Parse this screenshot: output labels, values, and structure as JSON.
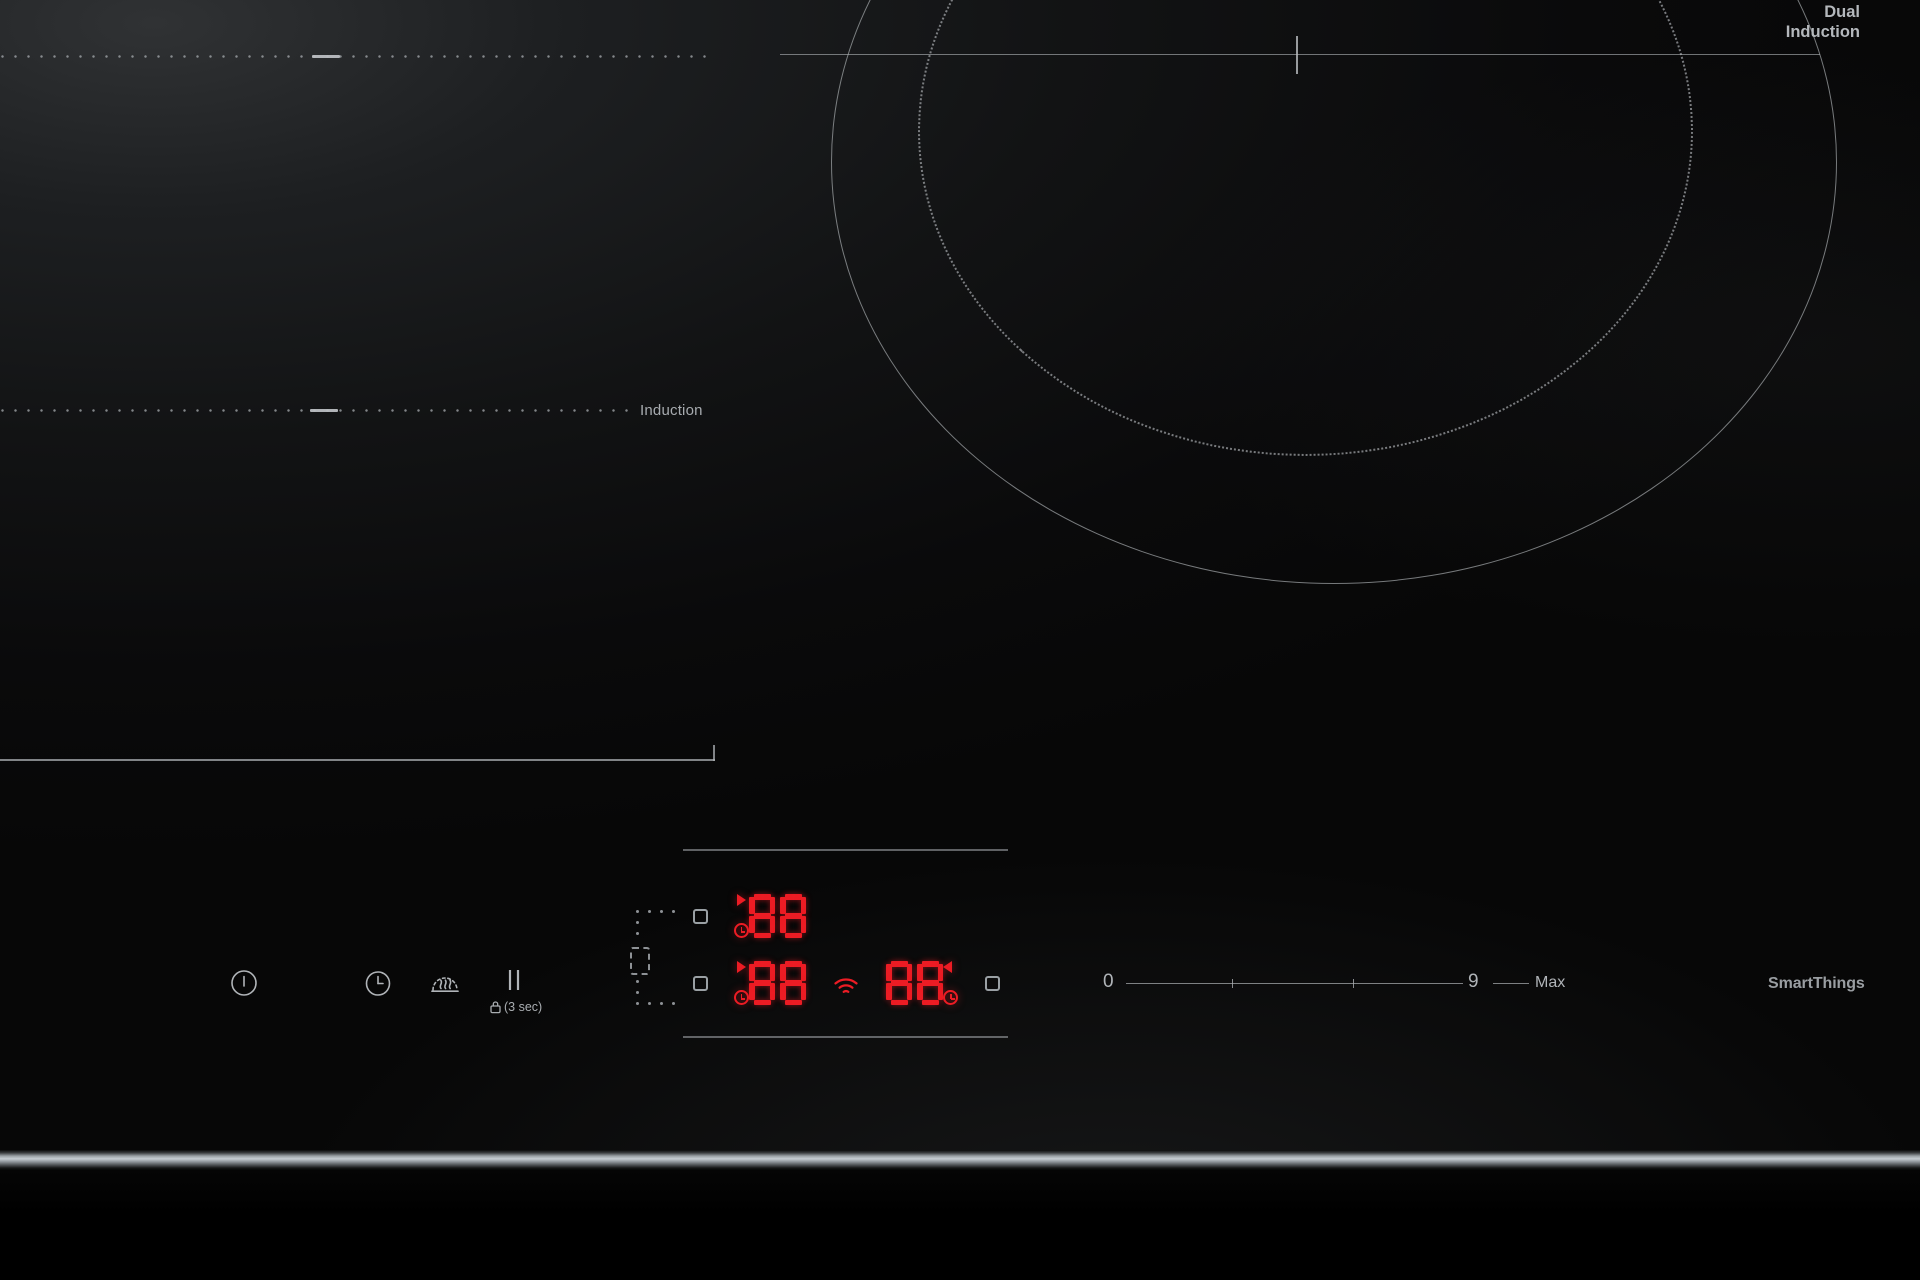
{
  "device": {
    "surface_color": "#0b0c0d",
    "accent_led_color": "#ec1c24",
    "line_color": "#b0b4b8"
  },
  "zone_labels": {
    "dual_induction": "Dual\nInduction",
    "induction": "Induction"
  },
  "controls": [
    {
      "id": "power",
      "name": "power-button",
      "label": "power"
    },
    {
      "id": "timer",
      "name": "timer-button",
      "label": "timer"
    },
    {
      "id": "keep_warm",
      "name": "keep-warm-button",
      "label": "keep-warm"
    },
    {
      "id": "pause",
      "name": "pause-button",
      "label": "pause",
      "sublabel": "(3 sec)",
      "sublabel_icon": "lock-icon"
    }
  ],
  "displays": {
    "zone_front_left": {
      "name": "display-front-left",
      "value": "88",
      "arrow": "right",
      "timer_icon": true
    },
    "zone_rear_left": {
      "name": "display-rear-left",
      "value": "88",
      "arrow": "right",
      "timer_icon": true
    },
    "zone_right": {
      "name": "display-right",
      "value": "88",
      "arrow": "left",
      "timer_icon": true
    }
  },
  "wifi": {
    "name": "wifi-icon",
    "state": "on"
  },
  "slider": {
    "min_label": "0",
    "max_label": "9",
    "boost_label": "Max",
    "tick_count": 2
  },
  "branding": {
    "smartthings": "SmartThings"
  },
  "flex_indicators": {
    "top_square": "flex-zone-marker-top",
    "mid_box": "flex-zone-link-box",
    "bottom_square": "flex-zone-marker-bottom",
    "right_square": "zone-marker-right"
  }
}
